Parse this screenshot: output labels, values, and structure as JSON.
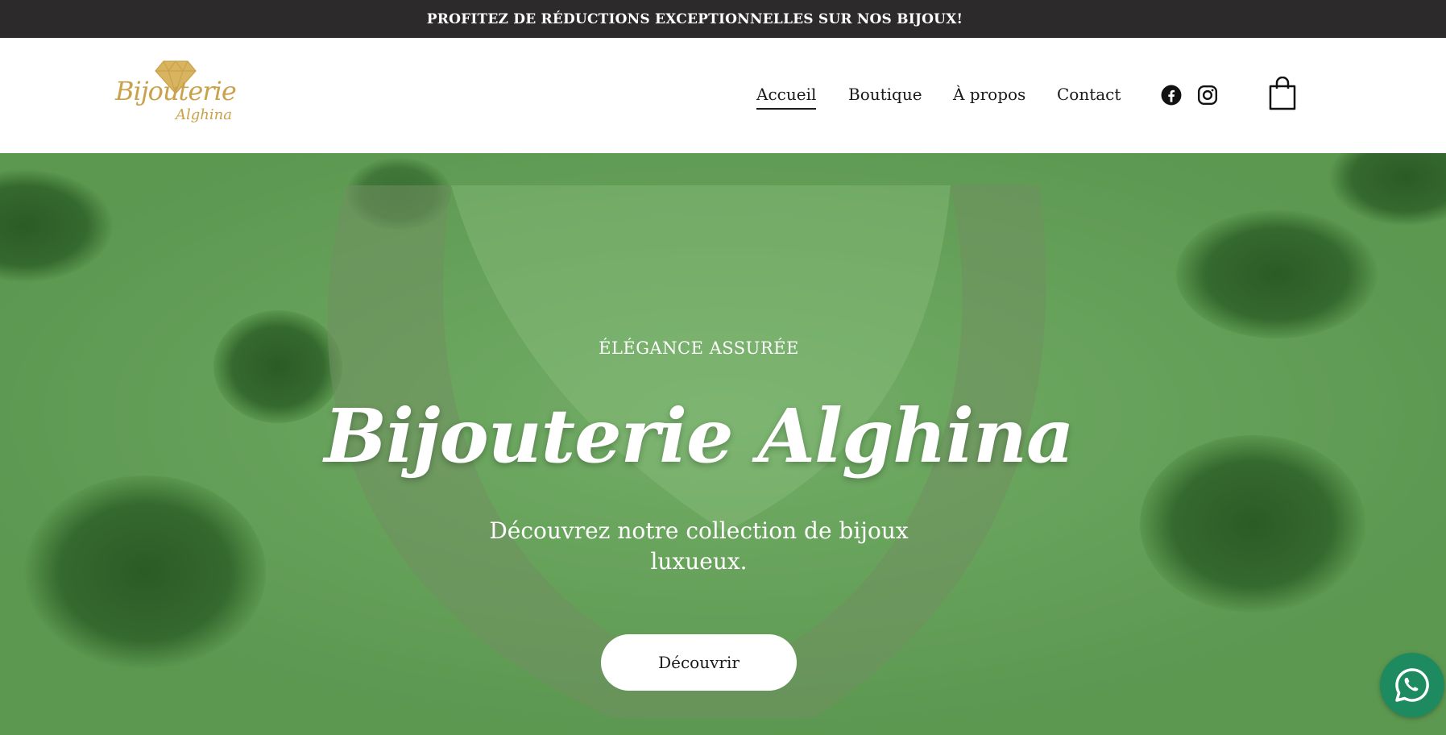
{
  "announcement": {
    "text": "PROFITEZ DE RÉDUCTIONS EXCEPTIONNELLES SUR NOS BIJOUX!"
  },
  "header": {
    "logo_line1": "Bijouterie",
    "logo_line2": "Alghina",
    "nav": [
      {
        "label": "Accueil",
        "active": true
      },
      {
        "label": "Boutique",
        "active": false
      },
      {
        "label": "À propos",
        "active": false
      },
      {
        "label": "Contact",
        "active": false
      }
    ],
    "social_icons": [
      "facebook-icon",
      "instagram-icon"
    ],
    "cart_icon": "shopping-bag-icon"
  },
  "hero": {
    "eyebrow": "ÉLÉGANCE ASSURÉE",
    "title": "Bijouterie Alghina",
    "subtitle": "Découvrez notre collection de bijoux luxueux.",
    "button_label": "Découvrir"
  },
  "floating": {
    "icon": "whatsapp-icon"
  },
  "colors": {
    "announcement_bg": "#2d2a2b",
    "hero_tint": "#5f9a53",
    "logo_gold": "#c9a24a",
    "whatsapp_green": "#1e8a5f"
  }
}
